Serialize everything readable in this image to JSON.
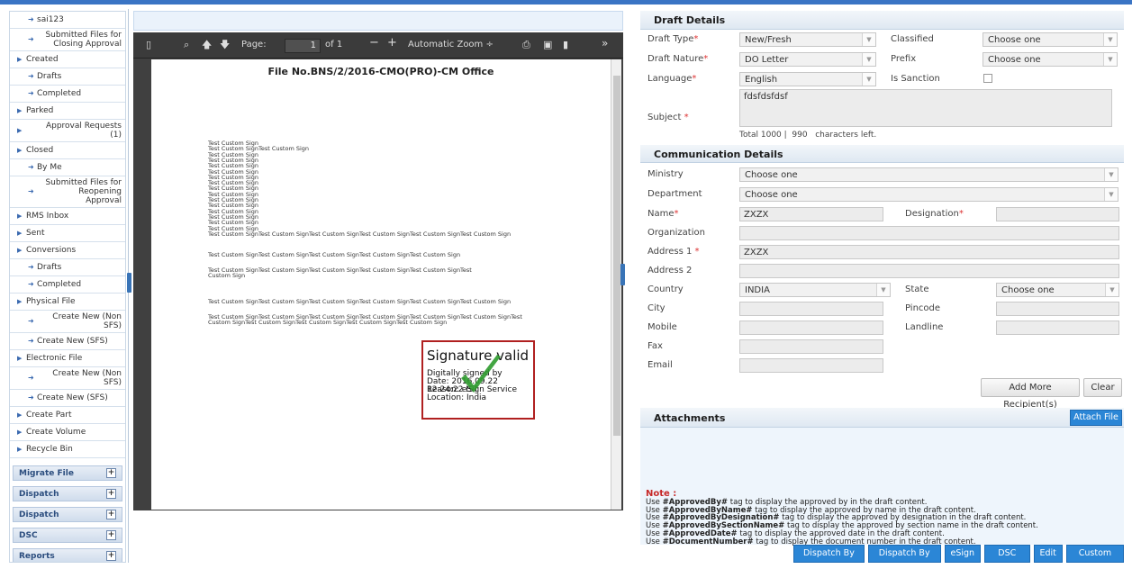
{
  "sidebar": {
    "items": [
      {
        "label": "sai123",
        "sub": true
      },
      {
        "label": "Submitted Files for\nClosing Approval",
        "sub": true
      },
      {
        "label": "Created",
        "sub": false
      },
      {
        "label": "Drafts",
        "sub": true
      },
      {
        "label": "Completed",
        "sub": true
      },
      {
        "label": "Parked",
        "sub": false
      },
      {
        "label": "Approval Requests\n(1)",
        "sub": false
      },
      {
        "label": "Closed",
        "sub": false
      },
      {
        "label": "By Me",
        "sub": true
      },
      {
        "label": "Submitted Files for\nReopening\nApproval",
        "sub": true
      },
      {
        "label": "RMS Inbox",
        "sub": false
      },
      {
        "label": "Sent",
        "sub": false
      },
      {
        "label": "Conversions",
        "sub": false
      },
      {
        "label": "Drafts",
        "sub": true
      },
      {
        "label": "Completed",
        "sub": true
      },
      {
        "label": "Physical File",
        "sub": false
      },
      {
        "label": "Create New (Non\nSFS)",
        "sub": true
      },
      {
        "label": "Create New (SFS)",
        "sub": true
      },
      {
        "label": "Electronic File",
        "sub": false
      },
      {
        "label": "Create New (Non\nSFS)",
        "sub": true
      },
      {
        "label": "Create New (SFS)",
        "sub": true
      },
      {
        "label": "Create Part",
        "sub": false
      },
      {
        "label": "Create Volume",
        "sub": false
      },
      {
        "label": "Recycle Bin",
        "sub": false
      }
    ],
    "sections": [
      "Migrate File",
      "Dispatch",
      "Dispatch",
      "DSC",
      "Reports"
    ]
  },
  "viewer": {
    "page_label": "Page:",
    "page_value": "1",
    "page_total": "of 1",
    "zoom": "Automatic Zoom",
    "file_heading": "File No.BNS/2/2016-CMO(PRO)-CM Office",
    "sign_lines": [
      "Test Custom Sign",
      "Test Custom SignTest Custom Sign",
      "Test Custom Sign",
      "Test Custom Sign",
      "Test Custom Sign",
      "Test Custom Sign",
      "Test Custom Sign",
      "Test Custom Sign",
      "Test Custom Sign",
      "Test Custom Sign",
      "Test Custom Sign",
      "Test Custom Sign",
      "Test Custom Sign",
      "Test Custom Sign",
      "Test Custom Sign",
      "Test Custom Sign",
      "Test Custom SignTest Custom SignTest Custom SignTest Custom SignTest Custom SignTest Custom Sign"
    ],
    "para1": "Test Custom SignTest Custom SignTest Custom SignTest Custom SignTest Custom Sign",
    "para2a": "Test Custom SignTest Custom SignTest Custom SignTest Custom SignTest Custom SignTest",
    "para2b": "Custom Sign",
    "para3": "Test Custom SignTest Custom SignTest Custom SignTest Custom SignTest Custom SignTest Custom Sign",
    "para4a": "Test Custom SignTest Custom SignTest Custom SignTest Custom SignTest Custom SignTest Custom SignTest",
    "para4b": "Custom SignTest Custom SignTest Custom SignTest Custom SignTest Custom Sign",
    "signature": {
      "title": "Signature valid",
      "l1": "Digitally signed by",
      "l2": "Date: 2016.09.22 12:24:22 IST",
      "l3": "Reason: eSign Service",
      "l4": "Location: India"
    }
  },
  "draft": {
    "title": "Draft Details",
    "draft_type_label": "Draft Type",
    "draft_type": "New/Fresh",
    "classified_label": "Classified",
    "classified": "Choose one",
    "draft_nature_label": "Draft Nature",
    "draft_nature": "DO Letter",
    "prefix_label": "Prefix",
    "prefix": "Choose one",
    "language_label": "Language",
    "language": "English",
    "sanction_label": "Is Sanction",
    "subject_label": "Subject",
    "subject": "fdsfdsfdsf",
    "total_chars": "Total 1000 |",
    "remaining": "990",
    "chars_left": "characters left."
  },
  "comm": {
    "title": "Communication Details",
    "ministry_label": "Ministry",
    "ministry": "Choose one",
    "department_label": "Department",
    "department": "Choose one",
    "name_label": "Name",
    "name": "ZXZX",
    "designation_label": "Designation",
    "organization_label": "Organization",
    "address1_label": "Address 1",
    "address1": "ZXZX",
    "address2_label": "Address 2",
    "country_label": "Country",
    "country": "INDIA",
    "state_label": "State",
    "state": "Choose one",
    "city_label": "City",
    "pincode_label": "Pincode",
    "mobile_label": "Mobile",
    "landline_label": "Landline",
    "fax_label": "Fax",
    "email_label": "Email",
    "add_recipient": "Add More Recipient(s)",
    "clear": "Clear"
  },
  "attachments": {
    "title": "Attachments",
    "attach_button": "Attach File"
  },
  "notes": {
    "title": "Note :",
    "lines": [
      {
        "pre": "Use ",
        "tag": "#ApprovedBy#",
        "post": " tag to display the approved by in the draft content."
      },
      {
        "pre": "Use ",
        "tag": "#ApprovedByName#",
        "post": " tag to display the approved by name in the draft content."
      },
      {
        "pre": "Use ",
        "tag": "#ApprovedByDesignation#",
        "post": " tag to display the approved by designation in the draft content."
      },
      {
        "pre": "Use ",
        "tag": "#ApprovedBySectionName#",
        "post": " tag to display the approved by section name in the draft content."
      },
      {
        "pre": "Use ",
        "tag": "#ApprovedDate#",
        "post": " tag to display the approved date in the draft content."
      },
      {
        "pre": "Use ",
        "tag": "#DocumentNumber#",
        "post": " tag to display the document number in the draft content."
      }
    ]
  },
  "actions": [
    "Dispatch By Self",
    "Dispatch By CRU",
    "eSign",
    "DSC Sign",
    "Edit",
    "Custom Sign"
  ],
  "colors": {
    "accent": "#2b86d6",
    "required": "#dd3333",
    "signature_border": "#b02020",
    "checkmark": "#2e9b2e"
  }
}
